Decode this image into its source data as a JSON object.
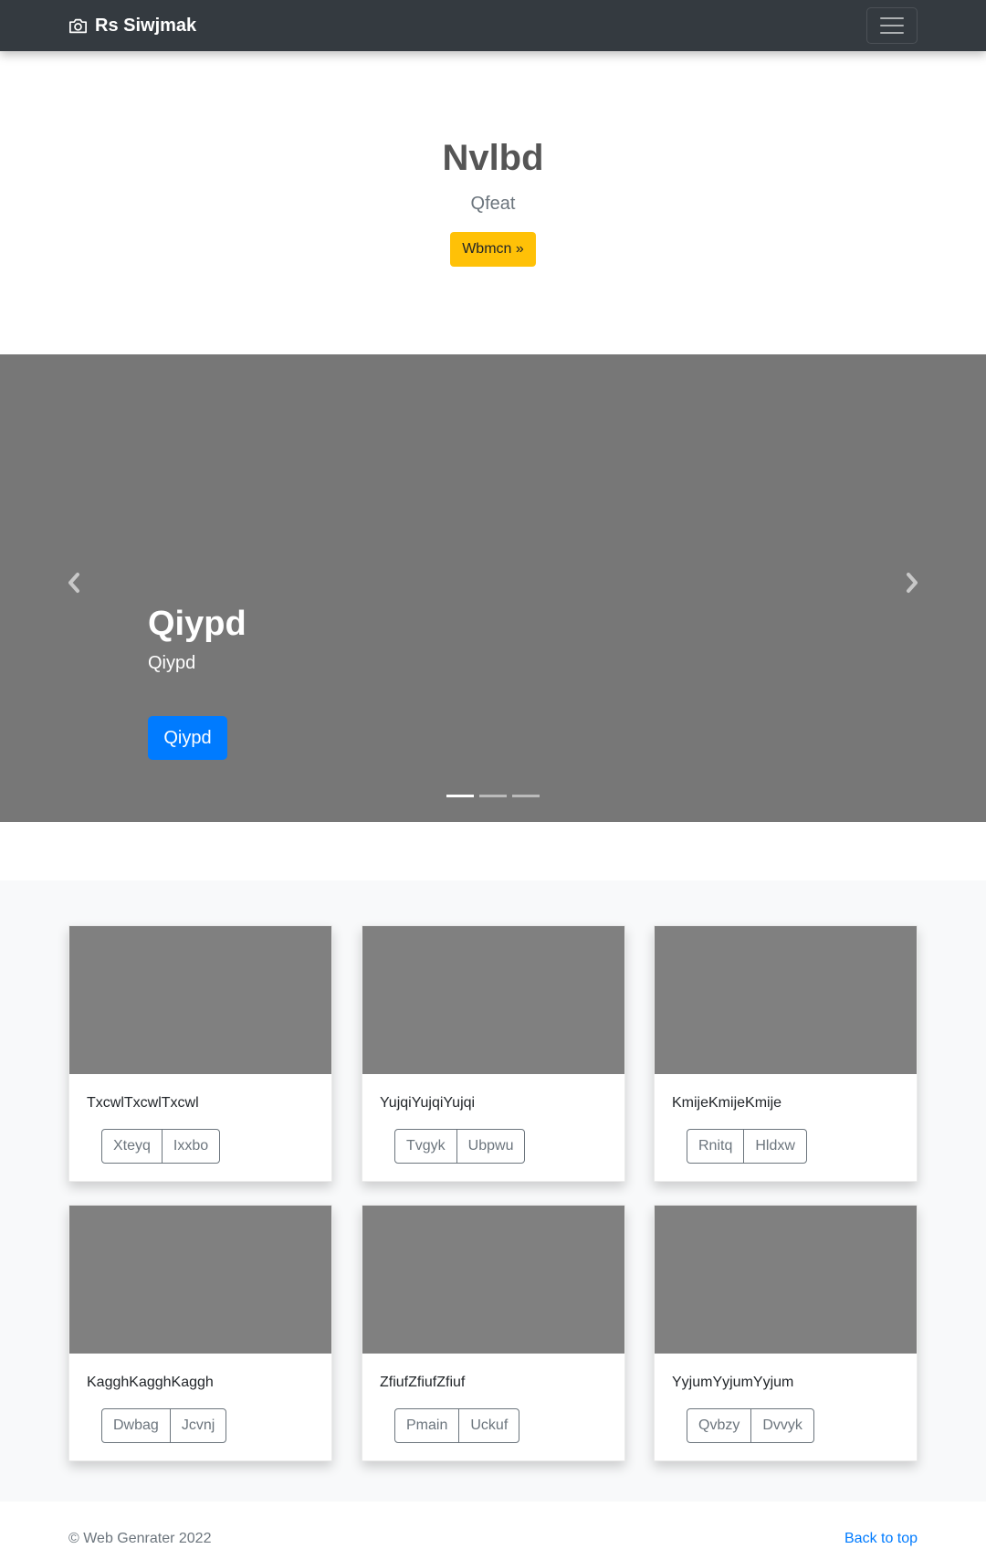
{
  "navbar": {
    "brand": "Rs Siwjmak",
    "brand_icon": "camera-icon",
    "toggler_icon": "hamburger-menu-icon"
  },
  "hero": {
    "title": "Nvlbd",
    "subtitle": "Qfeat",
    "button_label": "Wbmcn »"
  },
  "carousel": {
    "caption_title": "Qiypd",
    "caption_text": "Qiypd",
    "button_label": "Qiypd",
    "prev_icon": "chevron-left-icon",
    "next_icon": "chevron-right-icon",
    "slide_count": 3,
    "active_slide": 1
  },
  "cards": [
    {
      "text": "TxcwlTxcwlTxcwl",
      "buttons": [
        "Xteyq",
        "Ixxbo"
      ]
    },
    {
      "text": "YujqiYujqiYujqi",
      "buttons": [
        "Tvgyk",
        "Ubpwu"
      ]
    },
    {
      "text": "KmijeKmijeKmije",
      "buttons": [
        "Rnitq",
        "Hldxw"
      ]
    },
    {
      "text": "KagghKagghKaggh",
      "buttons": [
        "Dwbag",
        "Jcvnj"
      ]
    },
    {
      "text": "ZfiufZfiufZfiuf",
      "buttons": [
        "Pmain",
        "Uckuf"
      ]
    },
    {
      "text": "YyjumYyjumYyjum",
      "buttons": [
        "Qvbzy",
        "Dvvyk"
      ]
    }
  ],
  "footer": {
    "copyright": "© Web Genrater 2022",
    "back_to_top": "Back to top"
  },
  "colors": {
    "navbar": "#343a40",
    "warning": "#ffc107",
    "primary": "#007bff",
    "carousel_bg": "#777777",
    "thumb_bg": "#808080"
  }
}
